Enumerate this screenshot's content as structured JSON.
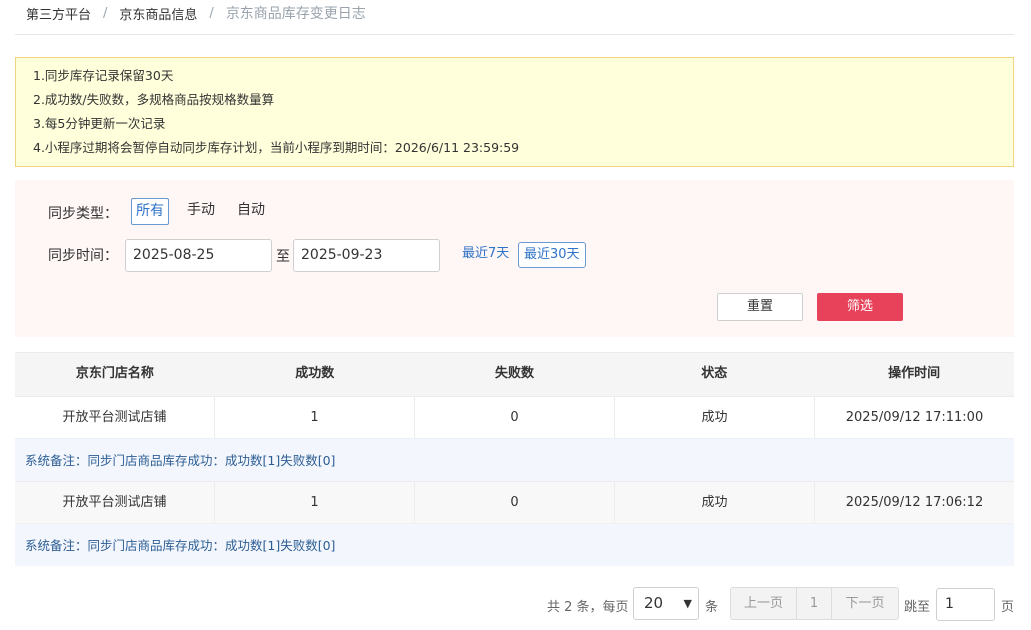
{
  "breadcrumb": {
    "items": [
      "第三方平台",
      "京东商品信息",
      "京东商品库存变更日志"
    ],
    "separator": "/"
  },
  "notice": {
    "lines": [
      "1.同步库存记录保留30天",
      "2.成功数/失败数，多规格商品按规格数量算",
      "3.每5分钟更新一次记录",
      "4.小程序过期将会暂停自动同步库存计划，当前小程序到期时间：2026/6/11 23:59:59"
    ]
  },
  "filter": {
    "sync_type_label": "同步类型：",
    "sync_type_options": [
      "所有",
      "手动",
      "自动"
    ],
    "sync_type_selected": "所有",
    "sync_time_label": "同步时间：",
    "start_date": "2025-08-25",
    "to_label": "至",
    "end_date": "2025-09-23",
    "quick_ranges": [
      "最近7天",
      "最近30天"
    ],
    "quick_selected": "最近30天",
    "reset_label": "重置",
    "filter_label": "筛选"
  },
  "table": {
    "columns": [
      "京东门店名称",
      "成功数",
      "失败数",
      "状态",
      "操作时间"
    ],
    "rows": [
      {
        "store": "开放平台测试店铺",
        "success": "1",
        "fail": "0",
        "status": "成功",
        "time": "2025/09/12 17:11:00",
        "remark": "系统备注：同步门店商品库存成功：成功数[1]失败数[0]"
      },
      {
        "store": "开放平台测试店铺",
        "success": "1",
        "fail": "0",
        "status": "成功",
        "time": "2025/09/12 17:06:12",
        "remark": "系统备注：同步门店商品库存成功：成功数[1]失败数[0]"
      }
    ]
  },
  "pagination": {
    "total_text": "共 2 条，每页",
    "page_size": "20",
    "unit": "条",
    "prev_label": "上一页",
    "current_page": "1",
    "next_label": "下一页",
    "jump_label": "跳至",
    "jump_value": "1",
    "page_unit": "页"
  },
  "colors": {
    "accent": "#e8425a",
    "link": "#2f73c8",
    "notice_bg": "#ffffdc",
    "notice_border": "#f2d37e",
    "filter_bg": "#fff6f6"
  }
}
